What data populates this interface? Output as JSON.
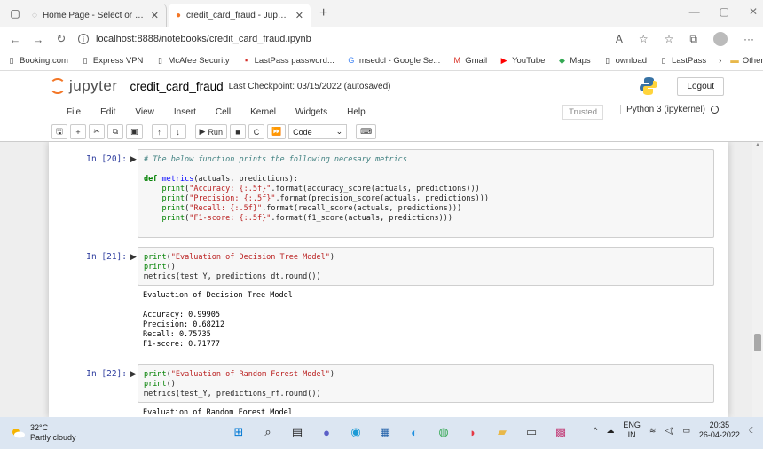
{
  "browser": {
    "tabs": [
      {
        "title": "Home Page - Select or create a n",
        "active": false
      },
      {
        "title": "credit_card_fraud - Jupyter Note",
        "active": true
      }
    ],
    "url": "localhost:8888/notebooks/credit_card_fraud.ipynb",
    "bookmarks": [
      {
        "label": "Booking.com",
        "icon": "page-icon"
      },
      {
        "label": "Express VPN",
        "icon": "page-icon"
      },
      {
        "label": "McAfee Security",
        "icon": "page-icon"
      },
      {
        "label": "LastPass password...",
        "icon": "lastpass-icon"
      },
      {
        "label": "msedcl - Google Se...",
        "icon": "google-icon"
      },
      {
        "label": "Gmail",
        "icon": "gmail-icon"
      },
      {
        "label": "YouTube",
        "icon": "youtube-icon"
      },
      {
        "label": "Maps",
        "icon": "maps-icon"
      },
      {
        "label": "ownload",
        "icon": "page-icon"
      },
      {
        "label": "LastPass",
        "icon": "page-icon"
      }
    ],
    "other_favorites": "Other favorites"
  },
  "jupyter": {
    "logo_text": "jupyter",
    "notebook_name": "credit_card_fraud",
    "checkpoint": "Last Checkpoint: 03/15/2022  (autosaved)",
    "logout": "Logout",
    "menus": [
      "File",
      "Edit",
      "View",
      "Insert",
      "Cell",
      "Kernel",
      "Widgets",
      "Help"
    ],
    "trusted": "Trusted",
    "kernel": "Python 3 (ipykernel)",
    "toolbar": {
      "run_label": "Run",
      "cell_type": "Code"
    }
  },
  "cells": [
    {
      "prompt": "In [20]:",
      "lines": [
        "# The below function prints the following necesary metrics",
        "",
        "def metrics(actuals, predictions):",
        "    print(\"Accuracy: {:.5f}\".format(accuracy_score(actuals, predictions)))",
        "    print(\"Precision: {:.5f}\".format(precision_score(actuals, predictions)))",
        "    print(\"Recall: {:.5f}\".format(recall_score(actuals, predictions)))",
        "    print(\"F1-score: {:.5f}\".format(f1_score(actuals, predictions)))",
        ""
      ],
      "output": ""
    },
    {
      "prompt": "In [21]:",
      "lines": [
        "print(\"Evaluation of Decision Tree Model\")",
        "print()",
        "metrics(test_Y, predictions_dt.round())"
      ],
      "output": "Evaluation of Decision Tree Model\n\nAccuracy: 0.99905\nPrecision: 0.68212\nRecall: 0.75735\nF1-score: 0.71777"
    },
    {
      "prompt": "In [22]:",
      "lines": [
        "print(\"Evaluation of Random Forest Model\")",
        "print()",
        "metrics(test_Y, predictions_rf.round())"
      ],
      "output": "Evaluation of Random Forest Model"
    }
  ],
  "taskbar": {
    "temperature": "32°C",
    "weather": "Partly cloudy",
    "lang_top": "ENG",
    "lang_bottom": "IN",
    "time": "20:35",
    "date": "26-04-2022"
  }
}
